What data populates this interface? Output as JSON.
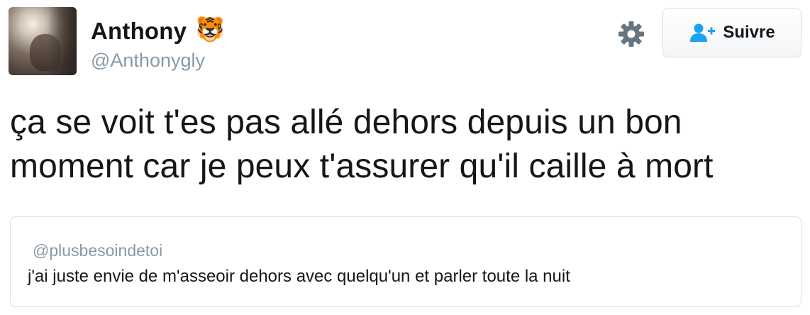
{
  "author": {
    "display_name": "Anthony",
    "emoji": "🐯",
    "handle": "@Anthonygly"
  },
  "actions": {
    "settings_icon": "gear-icon",
    "follow_label": "Suivre",
    "follow_icon": "add-user-icon",
    "accent_color": "#1da1f2"
  },
  "tweet": {
    "text": "ça se voit t'es pas allé dehors depuis un bon moment car je peux t'assurer qu'il caille à mort"
  },
  "quoted_tweet": {
    "handle": "@plusbesoindetoi",
    "text": "j'ai juste envie de m'asseoir dehors avec quelqu'un et parler toute la nuit"
  }
}
